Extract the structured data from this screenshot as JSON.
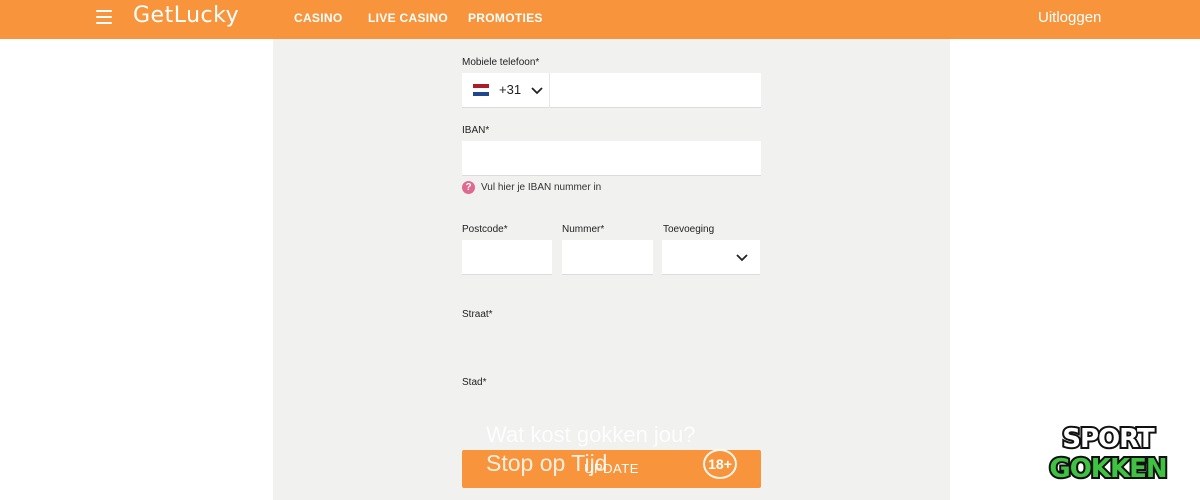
{
  "header": {
    "logo": "GetLucky",
    "nav": [
      "CASINO",
      "LIVE CASINO",
      "PROMOTIES"
    ],
    "logout": "Uitloggen",
    "accent_color": "#f8953c"
  },
  "form": {
    "phone": {
      "label": "Mobiele telefoon*",
      "prefix": "+31",
      "country_flag": "netherlands-flag-icon",
      "value": ""
    },
    "iban": {
      "label": "IBAN*",
      "value": "",
      "help": "Vul hier je IBAN nummer in"
    },
    "postcode": {
      "label": "Postcode*",
      "value": ""
    },
    "nummer": {
      "label": "Nummer*",
      "value": ""
    },
    "toevoeging": {
      "label": "Toevoeging",
      "value": ""
    },
    "straat": {
      "label": "Straat*"
    },
    "stad": {
      "label": "Stad*"
    },
    "submit": "UPDATE"
  },
  "overlay": {
    "line1": "Wat kost gokken jou?",
    "line2": "Stop op Tijd",
    "age_badge": "18+",
    "brand_line1": "SPORT",
    "brand_line2": "GOKKEN"
  }
}
